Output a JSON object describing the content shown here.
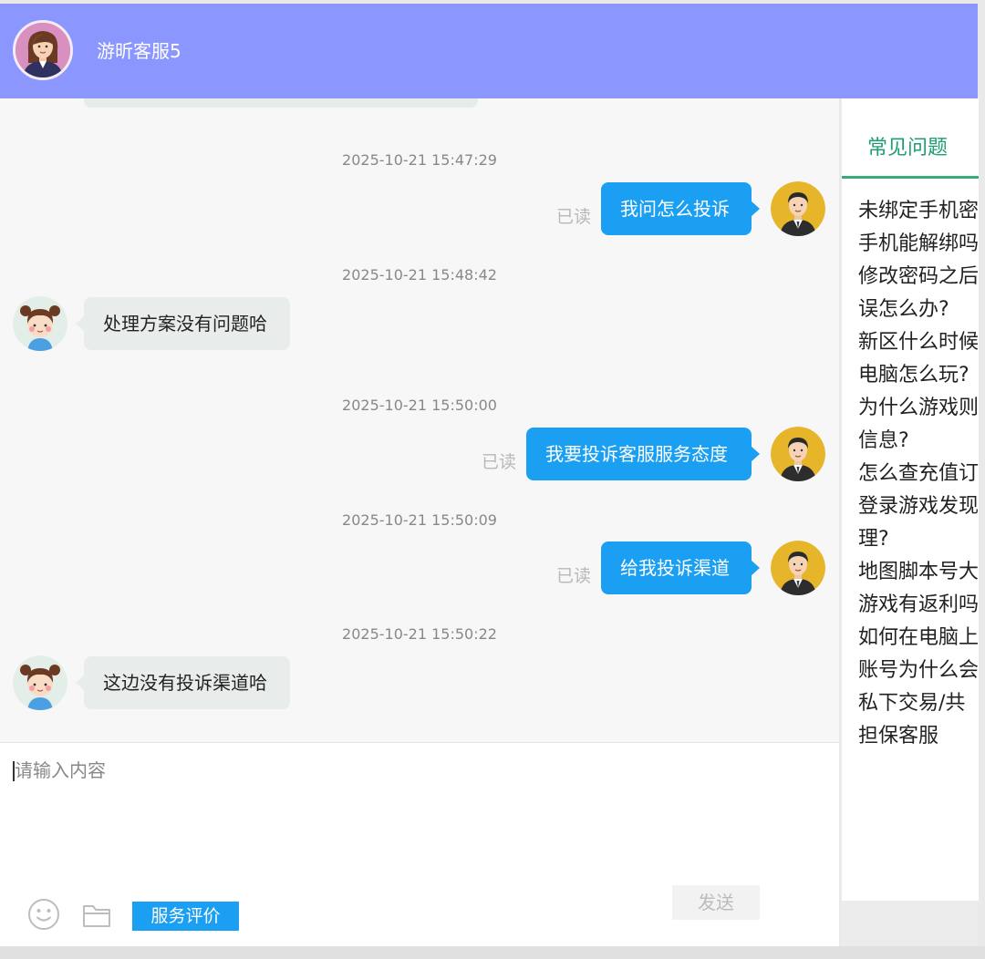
{
  "header": {
    "title": "游昕客服5",
    "avatar_icon": "agent-woman-avatar-icon",
    "background_color": "#8c96ff"
  },
  "chat": {
    "messages": [
      {
        "time": "2025-10-21 15:47:29",
        "direction": "out",
        "text": "我问怎么投诉",
        "status": "已读"
      },
      {
        "time": "2025-10-21 15:48:42",
        "direction": "in",
        "text": "处理方案没有问题哈"
      },
      {
        "time": "2025-10-21 15:50:00",
        "direction": "out",
        "text": "我要投诉客服服务态度",
        "status": "已读"
      },
      {
        "time": "2025-10-21 15:50:09",
        "direction": "out",
        "text": "给我投诉渠道",
        "status": "已读"
      },
      {
        "time": "2025-10-21 15:50:22",
        "direction": "in",
        "text": "这边没有投诉渠道哈"
      }
    ],
    "out_bubble_color": "#1a9ff2",
    "in_bubble_color": "#e8ecea"
  },
  "input": {
    "placeholder": "请输入内容",
    "emoji_icon": "smiley-icon",
    "file_icon": "folder-icon",
    "rate_label": "服务评价",
    "send_label": "发送"
  },
  "faq": {
    "tab_label": "常见问题",
    "accent_color": "#3aaa76",
    "lines": [
      "未绑定手机密",
      "手机能解绑吗",
      "修改密码之后",
      "误怎么办?",
      "新区什么时候",
      "电脑怎么玩?",
      "为什么游戏则",
      "信息?",
      "怎么查充值订",
      "登录游戏发现",
      "理?",
      "地图脚本号大",
      "游戏有返利吗",
      "如何在电脑上",
      "账号为什么会",
      "私下交易/共",
      "担保客服"
    ]
  }
}
